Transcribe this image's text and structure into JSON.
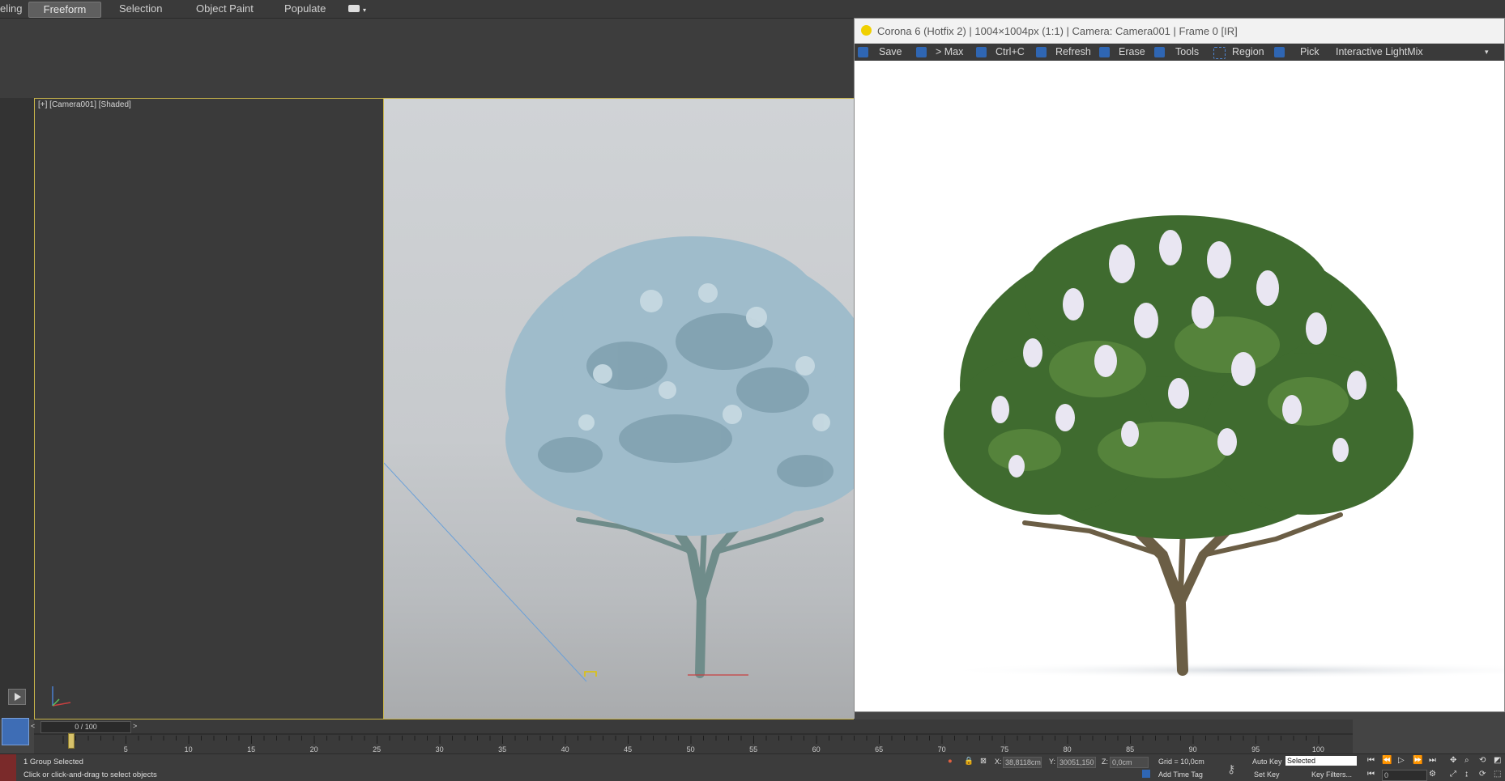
{
  "ribbon": {
    "tabs": [
      {
        "label": "eling"
      },
      {
        "label": "Freeform"
      },
      {
        "label": "Selection"
      },
      {
        "label": "Object Paint"
      },
      {
        "label": "Populate"
      }
    ],
    "active_tab": "Freeform"
  },
  "viewport": {
    "label": "[+] [Camera001] [Shaded]"
  },
  "render_window": {
    "title": "Corona 6 (Hotfix 2) | 1004×1004px (1:1) | Camera: Camera001 | Frame 0 [IR]",
    "toolbar": {
      "save": "Save",
      "to_max": "> Max",
      "copy": "Ctrl+C",
      "refresh": "Refresh",
      "erase": "Erase",
      "tools": "Tools",
      "region": "Region",
      "pick": "Pick",
      "lightmix": "Interactive LightMix"
    }
  },
  "timeline": {
    "slider_label": "0 / 100",
    "prev": "<",
    "next": ">",
    "ticks": [
      "5",
      "10",
      "15",
      "20",
      "25",
      "30",
      "35",
      "40",
      "45",
      "50",
      "55",
      "60",
      "65",
      "70",
      "75",
      "80",
      "85",
      "90",
      "95",
      "100"
    ]
  },
  "status": {
    "selection": "1 Group Selected",
    "prompt": "Click or click-and-drag to select objects",
    "coord_x_label": "X:",
    "coord_x": "38,8118cm",
    "coord_y_label": "Y:",
    "coord_y": "30051,150",
    "coord_z_label": "Z:",
    "coord_z": "0,0cm",
    "grid": "Grid = 10,0cm",
    "add_time_tag": "Add Time Tag",
    "auto_key": "Auto Key",
    "set_key": "Set Key",
    "selected": "Selected",
    "key_filters": "Key Filters...",
    "frame_field": "0"
  },
  "colors": {
    "accent_yellow": "#c9b54a",
    "toolbar_blue": "#2f66b3",
    "viewport_tree": "#8fb2c2",
    "render_foliage": "#3f6b2f",
    "render_blossom": "#e9e6f2"
  }
}
